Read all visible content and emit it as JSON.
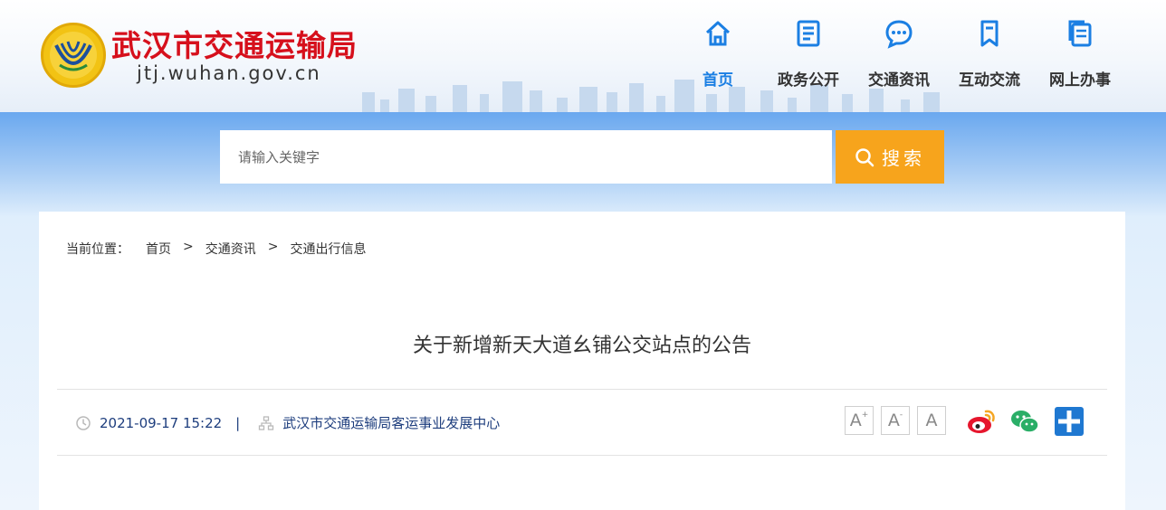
{
  "header": {
    "site_title": "武汉市交通运输局",
    "site_url": "jtj.wuhan.gov.cn"
  },
  "nav": {
    "items": [
      {
        "label": "首页",
        "icon": "home-icon",
        "active": true
      },
      {
        "label": "政务公开",
        "icon": "document-icon",
        "active": false
      },
      {
        "label": "交通资讯",
        "icon": "chat-icon",
        "active": false
      },
      {
        "label": "互动交流",
        "icon": "bookmark-icon",
        "active": false
      },
      {
        "label": "网上办事",
        "icon": "files-icon",
        "active": false
      }
    ]
  },
  "search": {
    "placeholder": "请输入关键字",
    "button_label": "搜索"
  },
  "breadcrumb": {
    "prefix": "当前位置：",
    "items": [
      "首页",
      "交通资讯",
      "交通出行信息"
    ],
    "separator": ">"
  },
  "article": {
    "title": "关于新增新天大道幺铺公交站点的公告",
    "datetime": "2021-09-17 15:22",
    "divider": "|",
    "source": "武汉市交通运输局客运事业发展中心"
  },
  "font_size_controls": {
    "increase": "A",
    "decrease": "A",
    "reset": "A",
    "increase_mark": "+",
    "decrease_mark": "-"
  },
  "share": {
    "icons": [
      "weibo-icon",
      "wechat-icon",
      "more-share-icon"
    ]
  },
  "colors": {
    "accent_blue": "#1b7fe3",
    "brand_red": "#d6101c",
    "search_orange": "#f7a41c",
    "meta_text": "#1d3d7d"
  }
}
